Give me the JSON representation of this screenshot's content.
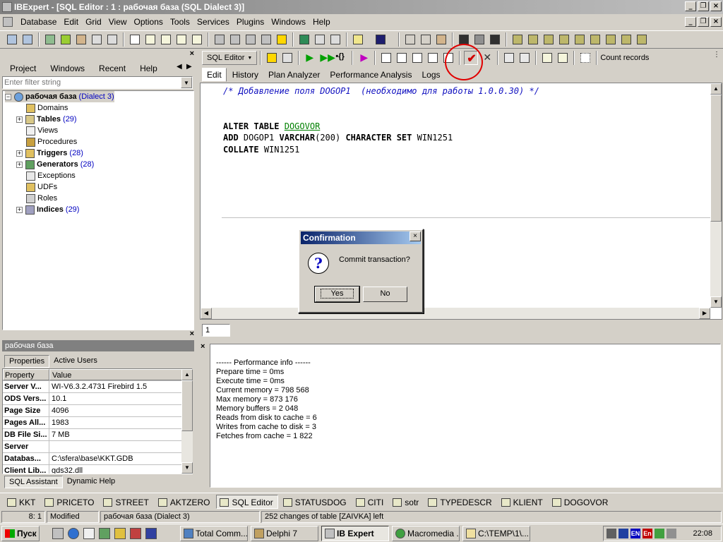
{
  "window": {
    "title": "IBExpert - [SQL Editor : 1 : рабочая база (SQL Dialect 3)]"
  },
  "menu": [
    "Database",
    "Edit",
    "Grid",
    "View",
    "Options",
    "Tools",
    "Services",
    "Plugins",
    "Windows",
    "Help"
  ],
  "left_panel": {
    "tabs": [
      "Project",
      "Windows",
      "Recent",
      "Help"
    ],
    "filter_placeholder": "Enter filter string",
    "tree": {
      "root_label": "рабочая база",
      "root_suffix": "(Dialect 3)",
      "items": [
        {
          "label": "Domains",
          "count": "",
          "expandable": false,
          "bold": false
        },
        {
          "label": "Tables",
          "count": "(29)",
          "expandable": true,
          "bold": true
        },
        {
          "label": "Views",
          "count": "",
          "expandable": false,
          "bold": false
        },
        {
          "label": "Procedures",
          "count": "",
          "expandable": false,
          "bold": false
        },
        {
          "label": "Triggers",
          "count": "(28)",
          "expandable": true,
          "bold": true
        },
        {
          "label": "Generators",
          "count": "(28)",
          "expandable": true,
          "bold": true
        },
        {
          "label": "Exceptions",
          "count": "",
          "expandable": false,
          "bold": false
        },
        {
          "label": "UDFs",
          "count": "",
          "expandable": false,
          "bold": false
        },
        {
          "label": "Roles",
          "count": "",
          "expandable": false,
          "bold": false
        },
        {
          "label": "Indices",
          "count": "(29)",
          "expandable": true,
          "bold": true
        }
      ]
    }
  },
  "db_panel": {
    "title": "рабочая база",
    "tabs": [
      "Properties",
      "Active Users"
    ],
    "header": {
      "property": "Property",
      "value": "Value"
    },
    "rows": [
      {
        "k": "Server V...",
        "v": "WI-V6.3.2.4731 Firebird 1.5"
      },
      {
        "k": "ODS Vers...",
        "v": "10.1"
      },
      {
        "k": "Page Size",
        "v": "4096"
      },
      {
        "k": "Pages All...",
        "v": "1983"
      },
      {
        "k": "DB File Si...",
        "v": "7 MB"
      },
      {
        "k": "Server",
        "v": ""
      },
      {
        "k": "Databas...",
        "v": "C:\\sfera\\base\\KKT.GDB"
      },
      {
        "k": "Client Lib...",
        "v": "gds32.dll"
      }
    ],
    "bottom_tabs": [
      "SQL Assistant",
      "Dynamic Help"
    ]
  },
  "editor_toolbar": {
    "sql_editor_label": "SQL Editor",
    "count_records": "Count records"
  },
  "editor_tabs": [
    "Edit",
    "History",
    "Plan Analyzer",
    "Performance Analysis",
    "Logs"
  ],
  "code": {
    "comment": "/* Добавление поля DOGOP1  (необходимо для работы 1.0.0.30) */",
    "l1_kw": "ALTER TABLE",
    "l1_id": "DOGOVOR",
    "l2_kw1": "ADD",
    "l2_field": "DOGOP1",
    "l2_kw2": "VARCHAR",
    "l2_size": "(200)",
    "l2_kw3": "CHARACTER SET",
    "l2_cs": "WIN1251",
    "l3_kw": "COLLATE",
    "l3_val": "WIN1251"
  },
  "line_position": "1",
  "performance": [
    "------ Performance info ------",
    "Prepare time = 0ms",
    "Execute time = 0ms",
    "Current memory = 798 568",
    "Max memory = 873 176",
    "Memory buffers = 2 048",
    "Reads from disk to cache = 6",
    "Writes from cache to disk = 3",
    "Fetches from cache = 1 822"
  ],
  "dialog": {
    "title": "Confirmation",
    "message": "Commit transaction?",
    "yes": "Yes",
    "no": "No"
  },
  "window_tabs": [
    "KKT",
    "PRICETO",
    "STREET",
    "AKTZERO",
    "SQL Editor",
    "STATUSDOG",
    "CITI",
    "sotr",
    "TYPEDESCR",
    "KLIENT",
    "DOGOVOR"
  ],
  "active_window_tab": "SQL Editor",
  "status": {
    "cursor": "8:    1",
    "modified": "Modified",
    "db": "рабочая база (Dialect 3)",
    "changes": "252 changes of table [ZAIVKA] left"
  },
  "taskbar": {
    "start": "Пуск",
    "buttons": [
      "Total Comm...",
      "Delphi 7",
      "IB Expert",
      "Macromedia ...",
      "C:\\TEMP\\1\\..."
    ],
    "active": "IB Expert",
    "tray_langs": [
      "EN",
      "En"
    ],
    "clock": "22:08"
  },
  "colors": {
    "title_inactive": "#808080",
    "dialog_title": "#0a246a",
    "comment": "#1010c0",
    "identifier": "#008000",
    "annotation_circle": "#e00000"
  }
}
